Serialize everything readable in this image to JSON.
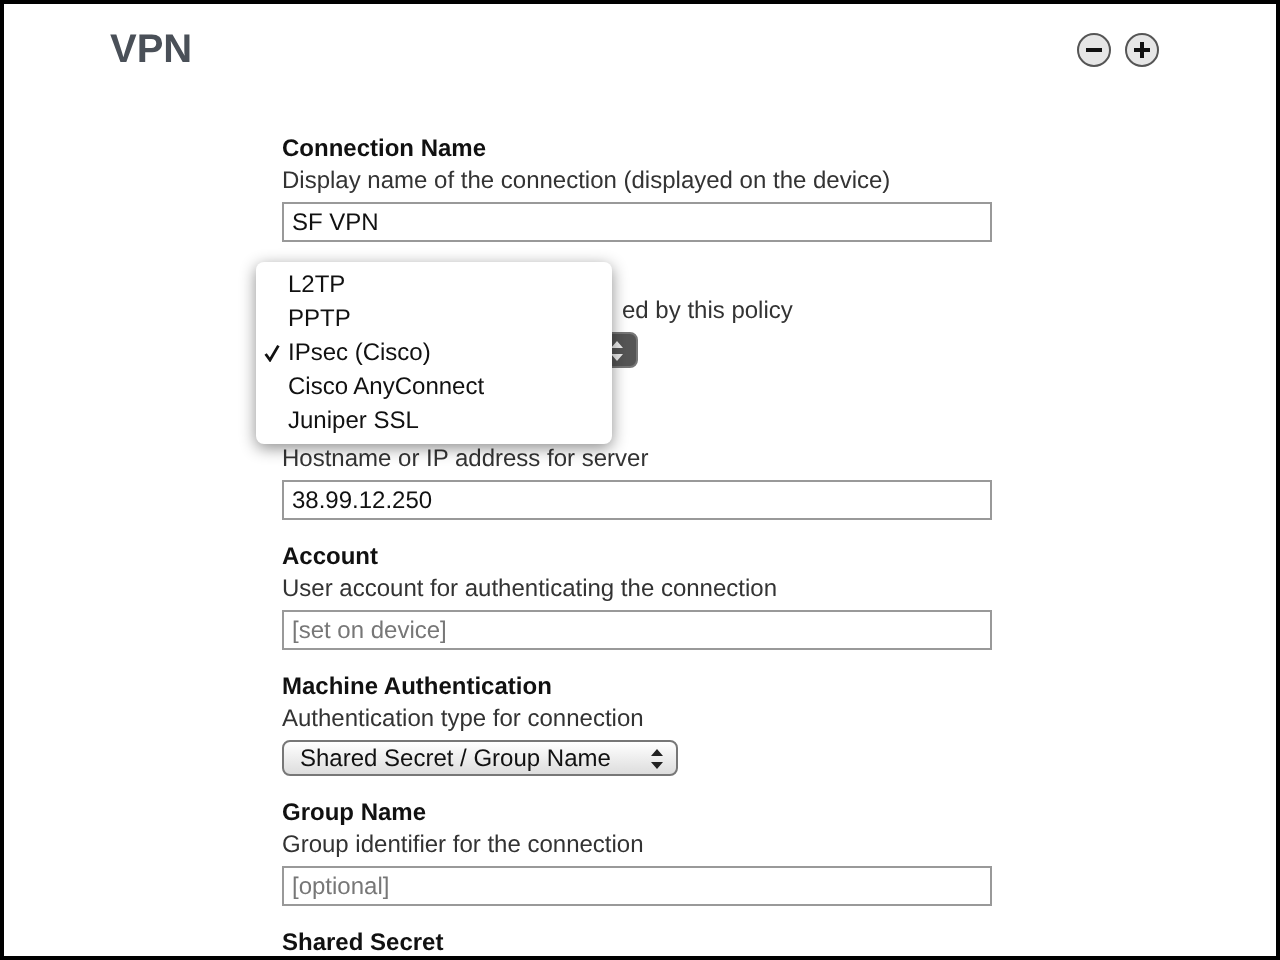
{
  "title": "VPN",
  "fields": [
    {
      "kind": "text",
      "label": "Connection Name",
      "description": "Display name of the connection (displayed on the device)",
      "value": "SF VPN"
    },
    {
      "kind": "covered-select",
      "description": "ed by this policy"
    },
    {
      "kind": "text",
      "description": "Hostname or IP address for server",
      "value": "38.99.12.250"
    },
    {
      "kind": "text",
      "label": "Account",
      "description": "User account for authenticating the connection",
      "placeholder": "[set on device]"
    },
    {
      "kind": "select",
      "label": "Machine Authentication",
      "description": "Authentication type for connection",
      "value": "Shared Secret / Group Name"
    },
    {
      "kind": "text",
      "label": "Group Name",
      "description": "Group identifier for the connection",
      "placeholder": "[optional]"
    },
    {
      "kind": "label",
      "label": "Shared Secret"
    }
  ],
  "menu": [
    {
      "label": "L2TP",
      "selected": false
    },
    {
      "label": "PPTP",
      "selected": false
    },
    {
      "label": "IPsec (Cisco)",
      "selected": true
    },
    {
      "label": "Cisco AnyConnect",
      "selected": false
    },
    {
      "label": "Juniper SSL",
      "selected": false
    }
  ]
}
